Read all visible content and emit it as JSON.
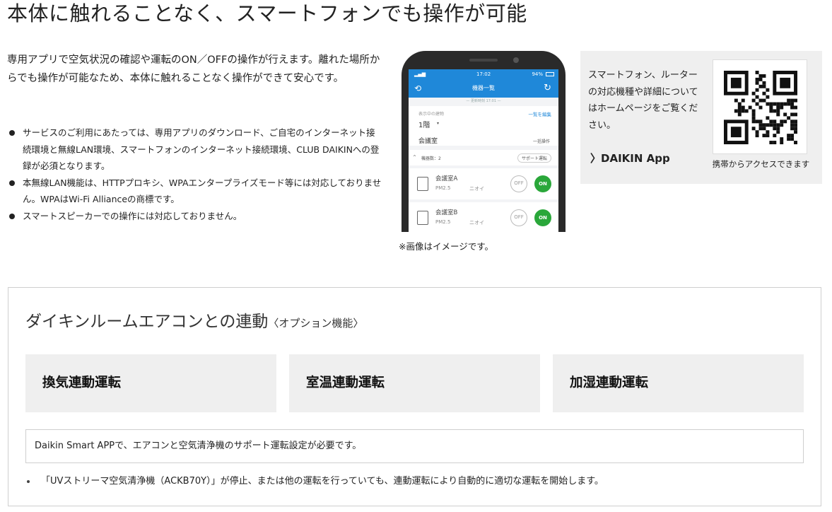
{
  "page": {
    "title": "本体に触れることなく、スマートフォンでも操作が可能",
    "intro": "専用アプリで空気状況の確認や運転のON／OFFの操作が行えます。離れた場所からでも操作が可能なため、本体に触れることなく操作ができて安心です。",
    "notes": [
      "サービスのご利用にあたっては、専用アプリのダウンロード、ご自宅のインターネット接続環境と無線LAN環境、スマートフォンのインターネット接続環境、CLUB DAIKINへの登録が必須となります。",
      "本無線LAN機能は、HTTPプロキシ、WPAエンタープライズモード等には対応しておりません。WPAはWi-Fi Allianceの商標です。",
      "スマートスピーカーでの操作には対応しておりません。"
    ],
    "image_caption": "※画像はイメージです。"
  },
  "phone": {
    "status_time": "17:02",
    "battery": "94%",
    "header_title": "機器一覧",
    "updated_text": "— 更新時刻 17:01 —",
    "display_label": "表示中の建物",
    "edit_link": "一覧を編集",
    "floor": "1階",
    "room": "会議室",
    "batch_op": "一括操作",
    "device_count": "機器数：2",
    "support_op": "サポート運転",
    "units": [
      {
        "name": "会議室A",
        "metrics": "PM2.5",
        "odor": "ニオイ",
        "off": "OFF",
        "on": "ON"
      },
      {
        "name": "会議室B",
        "metrics": "PM2.5",
        "odor": "ニオイ",
        "off": "OFF",
        "on": "ON"
      }
    ]
  },
  "info": {
    "text": "スマートフォン、ルーターの対応機種や詳細についてはホームページをご覧ください。",
    "app_link": "DAIKIN App",
    "qr_caption": "携帯からアクセスできます"
  },
  "panel": {
    "title": "ダイキンルームエアコンとの連動",
    "title_option": "〈オプション機能〉",
    "modes": [
      "換気連動運転",
      "室温連動運転",
      "加湿連動運転"
    ],
    "requirement": "Daikin Smart APPで、エアコンと空気清浄機のサポート運転設定が必要です。",
    "footnote": "「UVストリーマ空気清浄機（ACKB70Y）」が停止、または他の運転を行っていても、連動運転により自動的に適切な運転を開始します。"
  },
  "colors": {
    "app_blue": "#1f88d9",
    "on_green": "#2aa73a",
    "card_gray": "#efefef"
  }
}
